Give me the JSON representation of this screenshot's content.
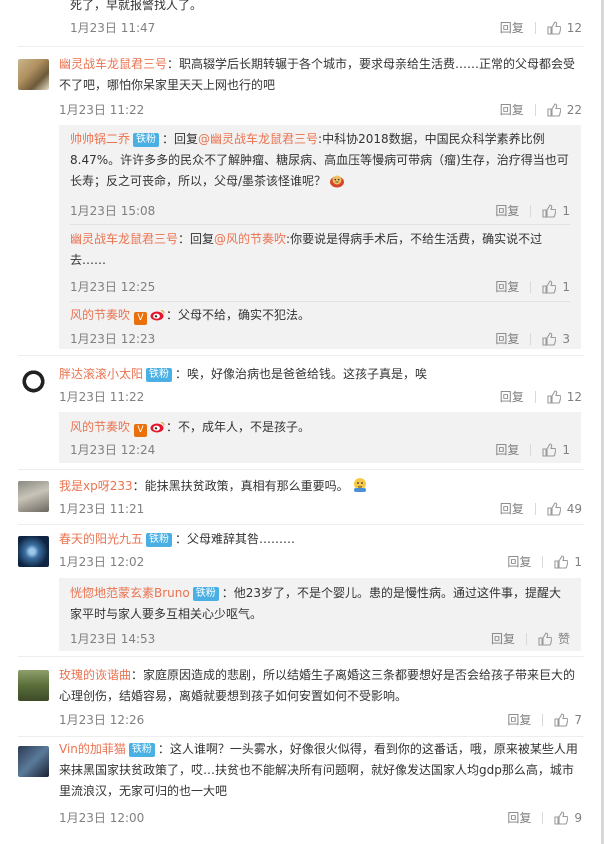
{
  "comments": [
    {
      "text_line1": "死了，早就报警找人了。",
      "time": "1月23日 11:47",
      "reply": "回复",
      "likes": "12"
    },
    {
      "user": "幽灵战车龙鼠君三号",
      "text": "：职高辍学后长期转辗于各个城市，要求母亲给生活费……正常的父母都会受不了吧，哪怕你呆家里天天上网也行的吧",
      "time": "1月23日 11:22",
      "reply": "回复",
      "likes": "22",
      "subs": [
        {
          "user": "帅帅锅二乔",
          "badge": "铁粉",
          "reply_prefix": "：回复",
          "reply_to": "@幽灵战车龙鼠君三号",
          "text": ":中科协2018数据，中国民众科学素养比例8.47%。许许多多的民众不了解肿瘤、糖尿病、高血压等慢病可带病（瘤)生存，治疗得当也可长寿；反之可丧命，所以，父母/墨茶该怪谁呢？",
          "time": "1月23日 15:08",
          "reply": "回复",
          "likes": "1"
        },
        {
          "user": "幽灵战车龙鼠君三号",
          "reply_prefix": "：回复",
          "reply_to": "@风的节奏吹",
          "text": ":你要说是得病手术后，不给生活费，确实说不过去……",
          "time": "1月23日 12:25",
          "reply": "回复",
          "likes": "1"
        },
        {
          "user": "风的节奏吹",
          "text": "：父母不给，确实不犯法。",
          "time": "1月23日 12:23",
          "reply": "回复",
          "likes": "3"
        }
      ]
    },
    {
      "user": "胖达滚滚小太阳",
      "badge": "铁粉",
      "text": "：唉，好像治病也是爸爸给钱。这孩子真是，唉",
      "time": "1月23日 11:22",
      "reply": "回复",
      "likes": "12",
      "subs": [
        {
          "user": "风的节奏吹",
          "text": "：不，成年人，不是孩子。",
          "time": "1月23日 12:24",
          "reply": "回复",
          "likes": "1"
        }
      ]
    },
    {
      "user": "我是xp呀233",
      "text": "：能抹黑扶贫政策，真相有那么重要吗。",
      "time": "1月23日 11:21",
      "reply": "回复",
      "likes": "49"
    },
    {
      "user": "春天的阳光九五",
      "badge": "铁粉",
      "text": "：父母难辞其咎………",
      "time": "1月23日 12:02",
      "reply": "回复",
      "likes": "1",
      "subs": [
        {
          "user": "恍惚地范蒙玄素Bruno",
          "badge": "铁粉",
          "text": "：他23岁了，不是个婴儿。患的是慢性病。通过这件事，提醒大家平时与家人要多互相关心少呕气。",
          "time": "1月23日 14:53",
          "reply": "回复",
          "likes": "赞"
        }
      ]
    },
    {
      "user": "玫瑰的诙谐曲",
      "text": "：家庭原因造成的悲剧，所以结婚生子离婚这三条都要想好是否会给孩子带来巨大的心理创伤，结婚容易，离婚就要想到孩子如何安置如何不受影响。",
      "time": "1月23日 12:26",
      "reply": "回复",
      "likes": "7"
    },
    {
      "user": "Vin的加菲猫",
      "badge": "铁粉",
      "text": "：这人谁啊？一头雾水，好像很火似得，看到你的这番话，哦，原来被某些人用来抹黑国家扶贫政策了，哎…扶贫也不能解决所有问题啊，就好像发达国家人均gdp那么高，城市里流浪汉，无家可归的也一大吧",
      "time": "1月23日 12:00",
      "reply": "回复",
      "likes": "9"
    }
  ],
  "icons": {
    "like": "thumbs-up-icon",
    "vip": "v-badge-icon",
    "weibo": "weibo-badge-icon"
  },
  "colors": {
    "username": "#eb7350",
    "badge": "#4ab0e3",
    "meta": "#808080",
    "subbox": "#f2f2f2"
  }
}
